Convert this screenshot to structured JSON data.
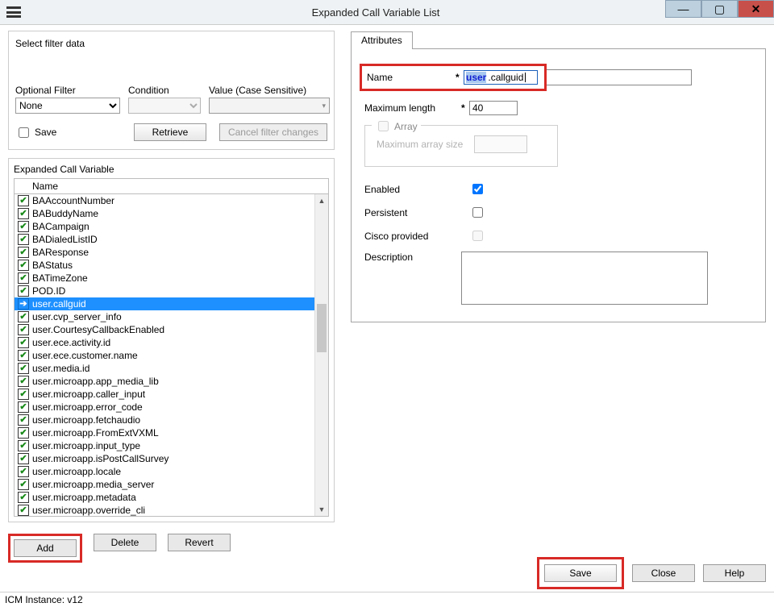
{
  "window": {
    "title": "Expanded Call Variable List"
  },
  "filter": {
    "section_label": "Select filter data",
    "optional_label": "Optional Filter",
    "optional_value": "None",
    "condition_label": "Condition",
    "value_label": "Value (Case Sensitive)",
    "save_label": "Save",
    "retrieve_label": "Retrieve",
    "cancel_label": "Cancel filter changes"
  },
  "list": {
    "group_label": "Expanded Call Variable",
    "column_header": "Name",
    "selected_index": 8,
    "items": [
      "BAAccountNumber",
      "BABuddyName",
      "BACampaign",
      "BADialedListID",
      "BAResponse",
      "BAStatus",
      "BATimeZone",
      "POD.ID",
      "user.callguid",
      "user.cvp_server_info",
      "user.CourtesyCallbackEnabled",
      "user.ece.activity.id",
      "user.ece.customer.name",
      "user.media.id",
      "user.microapp.app_media_lib",
      "user.microapp.caller_input",
      "user.microapp.error_code",
      "user.microapp.fetchaudio",
      "user.microapp.FromExtVXML",
      "user.microapp.input_type",
      "user.microapp.isPostCallSurvey",
      "user.microapp.locale",
      "user.microapp.media_server",
      "user.microapp.metadata",
      "user.microapp.override_cli"
    ]
  },
  "actions": {
    "add": "Add",
    "delete": "Delete",
    "revert": "Revert"
  },
  "attributes": {
    "tab_label": "Attributes",
    "name_label": "Name",
    "name_prefix": "user",
    "name_suffix": ".callguid",
    "maxlen_label": "Maximum length",
    "maxlen_value": "40",
    "array_label": "Array",
    "array_size_label": "Maximum array size",
    "enabled_label": "Enabled",
    "enabled_checked": true,
    "persistent_label": "Persistent",
    "persistent_checked": false,
    "cisco_label": "Cisco provided",
    "cisco_checked": false,
    "description_label": "Description",
    "description_value": ""
  },
  "footer": {
    "save": "Save",
    "close": "Close",
    "help": "Help"
  },
  "status": {
    "text": "ICM Instance: v12"
  }
}
